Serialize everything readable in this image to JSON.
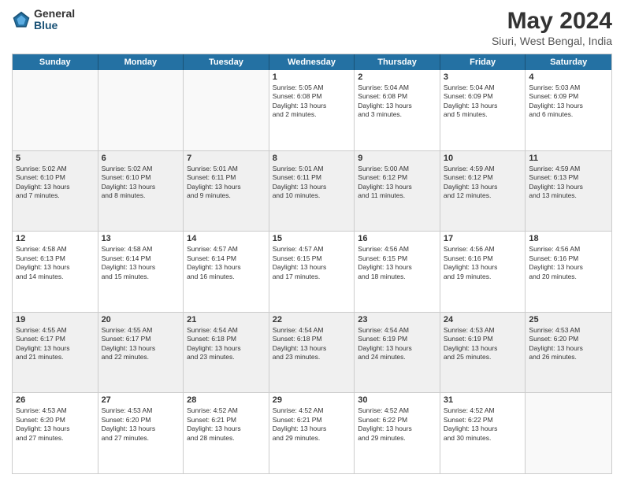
{
  "header": {
    "logo_general": "General",
    "logo_blue": "Blue",
    "title": "May 2024",
    "location": "Siuri, West Bengal, India"
  },
  "days_of_week": [
    "Sunday",
    "Monday",
    "Tuesday",
    "Wednesday",
    "Thursday",
    "Friday",
    "Saturday"
  ],
  "weeks": [
    [
      {
        "day": "",
        "empty": true
      },
      {
        "day": "",
        "empty": true
      },
      {
        "day": "",
        "empty": true
      },
      {
        "day": "1",
        "line1": "Sunrise: 5:05 AM",
        "line2": "Sunset: 6:08 PM",
        "line3": "Daylight: 13 hours",
        "line4": "and 2 minutes."
      },
      {
        "day": "2",
        "line1": "Sunrise: 5:04 AM",
        "line2": "Sunset: 6:08 PM",
        "line3": "Daylight: 13 hours",
        "line4": "and 3 minutes."
      },
      {
        "day": "3",
        "line1": "Sunrise: 5:04 AM",
        "line2": "Sunset: 6:09 PM",
        "line3": "Daylight: 13 hours",
        "line4": "and 5 minutes."
      },
      {
        "day": "4",
        "line1": "Sunrise: 5:03 AM",
        "line2": "Sunset: 6:09 PM",
        "line3": "Daylight: 13 hours",
        "line4": "and 6 minutes."
      }
    ],
    [
      {
        "day": "5",
        "line1": "Sunrise: 5:02 AM",
        "line2": "Sunset: 6:10 PM",
        "line3": "Daylight: 13 hours",
        "line4": "and 7 minutes."
      },
      {
        "day": "6",
        "line1": "Sunrise: 5:02 AM",
        "line2": "Sunset: 6:10 PM",
        "line3": "Daylight: 13 hours",
        "line4": "and 8 minutes."
      },
      {
        "day": "7",
        "line1": "Sunrise: 5:01 AM",
        "line2": "Sunset: 6:11 PM",
        "line3": "Daylight: 13 hours",
        "line4": "and 9 minutes."
      },
      {
        "day": "8",
        "line1": "Sunrise: 5:01 AM",
        "line2": "Sunset: 6:11 PM",
        "line3": "Daylight: 13 hours",
        "line4": "and 10 minutes."
      },
      {
        "day": "9",
        "line1": "Sunrise: 5:00 AM",
        "line2": "Sunset: 6:12 PM",
        "line3": "Daylight: 13 hours",
        "line4": "and 11 minutes."
      },
      {
        "day": "10",
        "line1": "Sunrise: 4:59 AM",
        "line2": "Sunset: 6:12 PM",
        "line3": "Daylight: 13 hours",
        "line4": "and 12 minutes."
      },
      {
        "day": "11",
        "line1": "Sunrise: 4:59 AM",
        "line2": "Sunset: 6:13 PM",
        "line3": "Daylight: 13 hours",
        "line4": "and 13 minutes."
      }
    ],
    [
      {
        "day": "12",
        "line1": "Sunrise: 4:58 AM",
        "line2": "Sunset: 6:13 PM",
        "line3": "Daylight: 13 hours",
        "line4": "and 14 minutes."
      },
      {
        "day": "13",
        "line1": "Sunrise: 4:58 AM",
        "line2": "Sunset: 6:14 PM",
        "line3": "Daylight: 13 hours",
        "line4": "and 15 minutes."
      },
      {
        "day": "14",
        "line1": "Sunrise: 4:57 AM",
        "line2": "Sunset: 6:14 PM",
        "line3": "Daylight: 13 hours",
        "line4": "and 16 minutes."
      },
      {
        "day": "15",
        "line1": "Sunrise: 4:57 AM",
        "line2": "Sunset: 6:15 PM",
        "line3": "Daylight: 13 hours",
        "line4": "and 17 minutes."
      },
      {
        "day": "16",
        "line1": "Sunrise: 4:56 AM",
        "line2": "Sunset: 6:15 PM",
        "line3": "Daylight: 13 hours",
        "line4": "and 18 minutes."
      },
      {
        "day": "17",
        "line1": "Sunrise: 4:56 AM",
        "line2": "Sunset: 6:16 PM",
        "line3": "Daylight: 13 hours",
        "line4": "and 19 minutes."
      },
      {
        "day": "18",
        "line1": "Sunrise: 4:56 AM",
        "line2": "Sunset: 6:16 PM",
        "line3": "Daylight: 13 hours",
        "line4": "and 20 minutes."
      }
    ],
    [
      {
        "day": "19",
        "line1": "Sunrise: 4:55 AM",
        "line2": "Sunset: 6:17 PM",
        "line3": "Daylight: 13 hours",
        "line4": "and 21 minutes."
      },
      {
        "day": "20",
        "line1": "Sunrise: 4:55 AM",
        "line2": "Sunset: 6:17 PM",
        "line3": "Daylight: 13 hours",
        "line4": "and 22 minutes."
      },
      {
        "day": "21",
        "line1": "Sunrise: 4:54 AM",
        "line2": "Sunset: 6:18 PM",
        "line3": "Daylight: 13 hours",
        "line4": "and 23 minutes."
      },
      {
        "day": "22",
        "line1": "Sunrise: 4:54 AM",
        "line2": "Sunset: 6:18 PM",
        "line3": "Daylight: 13 hours",
        "line4": "and 23 minutes."
      },
      {
        "day": "23",
        "line1": "Sunrise: 4:54 AM",
        "line2": "Sunset: 6:19 PM",
        "line3": "Daylight: 13 hours",
        "line4": "and 24 minutes."
      },
      {
        "day": "24",
        "line1": "Sunrise: 4:53 AM",
        "line2": "Sunset: 6:19 PM",
        "line3": "Daylight: 13 hours",
        "line4": "and 25 minutes."
      },
      {
        "day": "25",
        "line1": "Sunrise: 4:53 AM",
        "line2": "Sunset: 6:20 PM",
        "line3": "Daylight: 13 hours",
        "line4": "and 26 minutes."
      }
    ],
    [
      {
        "day": "26",
        "line1": "Sunrise: 4:53 AM",
        "line2": "Sunset: 6:20 PM",
        "line3": "Daylight: 13 hours",
        "line4": "and 27 minutes."
      },
      {
        "day": "27",
        "line1": "Sunrise: 4:53 AM",
        "line2": "Sunset: 6:20 PM",
        "line3": "Daylight: 13 hours",
        "line4": "and 27 minutes."
      },
      {
        "day": "28",
        "line1": "Sunrise: 4:52 AM",
        "line2": "Sunset: 6:21 PM",
        "line3": "Daylight: 13 hours",
        "line4": "and 28 minutes."
      },
      {
        "day": "29",
        "line1": "Sunrise: 4:52 AM",
        "line2": "Sunset: 6:21 PM",
        "line3": "Daylight: 13 hours",
        "line4": "and 29 minutes."
      },
      {
        "day": "30",
        "line1": "Sunrise: 4:52 AM",
        "line2": "Sunset: 6:22 PM",
        "line3": "Daylight: 13 hours",
        "line4": "and 29 minutes."
      },
      {
        "day": "31",
        "line1": "Sunrise: 4:52 AM",
        "line2": "Sunset: 6:22 PM",
        "line3": "Daylight: 13 hours",
        "line4": "and 30 minutes."
      },
      {
        "day": "",
        "empty": true
      }
    ]
  ]
}
